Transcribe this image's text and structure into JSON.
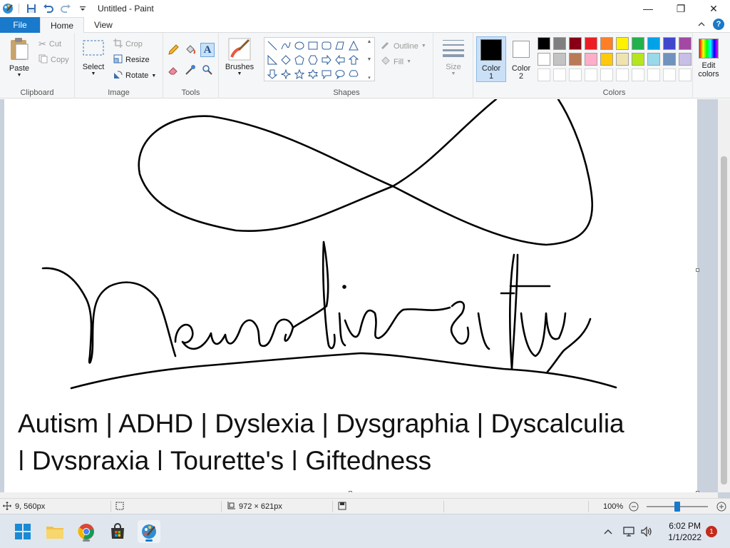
{
  "window": {
    "title": "Untitled - Paint",
    "minimize_glyph": "—",
    "maximize_glyph": "❐",
    "close_glyph": "✕"
  },
  "tabs": [
    {
      "label": "File"
    },
    {
      "label": "Home"
    },
    {
      "label": "View"
    }
  ],
  "ribbon": {
    "clipboard": {
      "label": "Clipboard",
      "paste": "Paste",
      "cut": "Cut",
      "copy": "Copy"
    },
    "image": {
      "label": "Image",
      "select": "Select",
      "crop": "Crop",
      "resize": "Resize",
      "rotate": "Rotate"
    },
    "tools": {
      "label": "Tools"
    },
    "brushes": {
      "label": "Brushes"
    },
    "shapes": {
      "label": "Shapes",
      "outline": "Outline",
      "fill": "Fill"
    },
    "size": {
      "label": "Size"
    },
    "color1": {
      "label": "Color",
      "num": "1",
      "value": "#000000"
    },
    "color2": {
      "label": "Color",
      "num": "2",
      "value": "#ffffff"
    },
    "colors": {
      "label": "Colors",
      "edit_line1": "Edit",
      "edit_line2": "colors"
    },
    "palette_row1": [
      "#000000",
      "#7f7f7f",
      "#880015",
      "#ed1c24",
      "#ff7f27",
      "#fff200",
      "#22b14c",
      "#00a2e8",
      "#3f48cc",
      "#a349a4"
    ],
    "palette_row2": [
      "#ffffff",
      "#c3c3c3",
      "#b97a57",
      "#ffaec9",
      "#ffc90e",
      "#efe4b0",
      "#b5e61d",
      "#99d9ea",
      "#7092be",
      "#c8bfe7"
    ]
  },
  "canvas": {
    "text_line1": "Autism | ADHD | Dyslexia | Dysgraphia | Dyscalculia",
    "text_line2": "| Dyspraxia | Tourette's | Giftedness"
  },
  "status": {
    "cursor_pos": "9, 560px",
    "canvas_size": "972 × 621px",
    "zoom": "100%"
  },
  "taskbar": {
    "time": "6:02 PM",
    "date": "1/1/2022",
    "notifications": "1"
  }
}
